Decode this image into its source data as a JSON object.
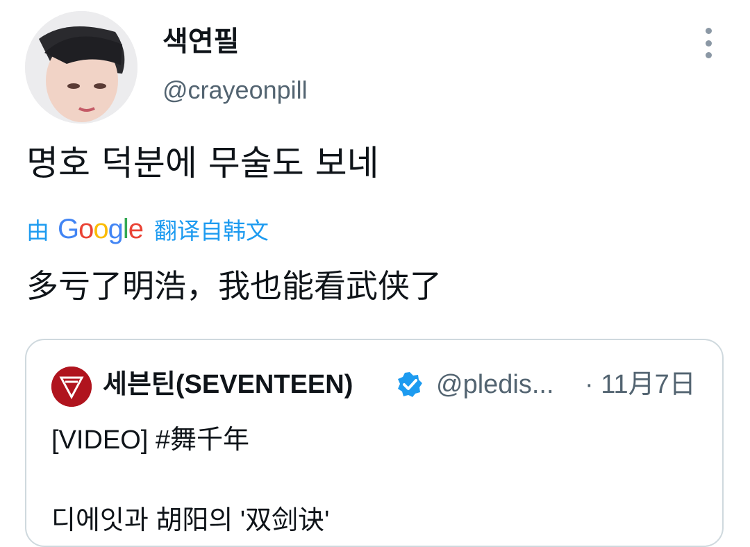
{
  "author": {
    "display_name": "색연필",
    "handle": "@crayeonpill",
    "avatar_icon": "profile-photo"
  },
  "tweet": {
    "text": "명호 덕분에 무술도 보네",
    "translation_prefix": "由",
    "translation_provider": "Google",
    "translation_suffix": "翻译自韩文",
    "translated_text": "多亏了明浩，我也能看武侠了"
  },
  "quoted_tweet": {
    "display_name": "세븐틴(SEVENTEEN)",
    "handle": "@pledis...",
    "time": "· 11月7日",
    "verified_icon": "verified-badge",
    "line1": "[VIDEO] #舞千年",
    "line2": "디에잇과 胡阳의 '双剑诀'"
  },
  "colors": {
    "link_blue": "#1d9bf0",
    "secondary_text": "#536471",
    "border": "#cfd9de",
    "brand_red": "#b0141e"
  }
}
